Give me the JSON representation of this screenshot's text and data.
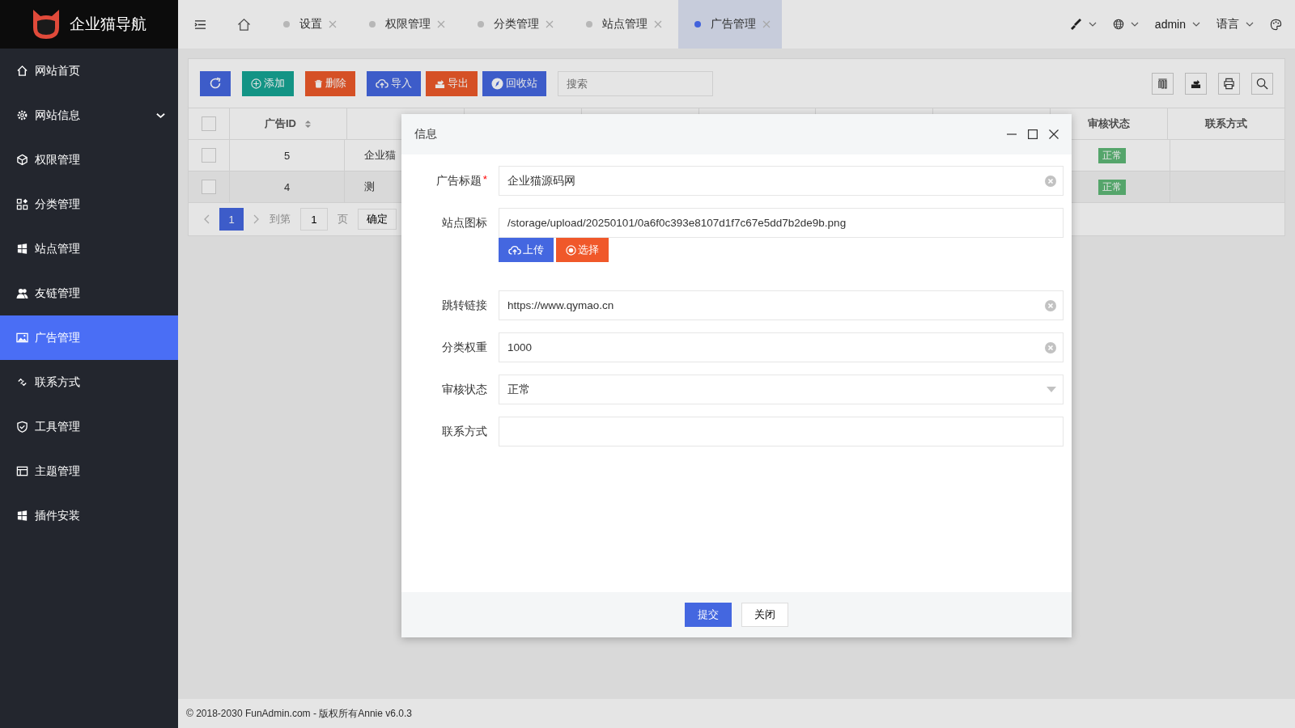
{
  "sidebar": {
    "logo_text": "企业猫导航",
    "items": [
      {
        "label": "网站首页",
        "selected": false,
        "expandable": false
      },
      {
        "label": "网站信息",
        "selected": false,
        "expandable": true
      },
      {
        "label": "权限管理",
        "selected": false,
        "expandable": false
      },
      {
        "label": "分类管理",
        "selected": false,
        "expandable": false
      },
      {
        "label": "站点管理",
        "selected": false,
        "expandable": false
      },
      {
        "label": "友链管理",
        "selected": false,
        "expandable": false
      },
      {
        "label": "广告管理",
        "selected": true,
        "expandable": false
      },
      {
        "label": "联系方式",
        "selected": false,
        "expandable": false
      },
      {
        "label": "工具管理",
        "selected": false,
        "expandable": false
      },
      {
        "label": "主题管理",
        "selected": false,
        "expandable": false
      },
      {
        "label": "插件安装",
        "selected": false,
        "expandable": false
      }
    ]
  },
  "tabs": [
    {
      "label": "设置",
      "selected": false
    },
    {
      "label": "权限管理",
      "selected": false
    },
    {
      "label": "分类管理",
      "selected": false
    },
    {
      "label": "站点管理",
      "selected": false
    },
    {
      "label": "广告管理",
      "selected": true
    }
  ],
  "user_menu": {
    "username": "admin",
    "language": "语言"
  },
  "toolbar": {
    "buttons": [
      {
        "kind": "refresh"
      },
      {
        "kind": "add",
        "label": "添加"
      },
      {
        "kind": "delete",
        "label": "删除"
      },
      {
        "kind": "import",
        "label": "导入"
      },
      {
        "kind": "export",
        "label": "导出"
      },
      {
        "kind": "recycle",
        "label": "回收站"
      }
    ],
    "search": {
      "placeholder": "搜索"
    }
  },
  "table": {
    "columns": [
      {
        "label": "广告ID",
        "sortable": true
      },
      {
        "label": "审核状态",
        "sortable": false
      },
      {
        "label": "联系方式",
        "sortable": false
      }
    ],
    "select_all_checked": false,
    "rows": [
      {
        "checked": false,
        "id": "5",
        "title": "企业猫",
        "status": "正常",
        "highlighted": false
      },
      {
        "checked": false,
        "id": "4",
        "title": "测",
        "status": "正常",
        "highlighted": true
      }
    ],
    "pagination": {
      "current": "1",
      "goto_label": "到第",
      "page_input": "1",
      "page_unit": "页",
      "confirm": "确定"
    }
  },
  "modal": {
    "title": "信息",
    "fields": [
      {
        "kind": "text",
        "label": "广告标题",
        "required_mark": "*",
        "value": "企业猫源码网",
        "clearable": true
      },
      {
        "kind": "upload",
        "label": "站点图标",
        "value": "/storage/upload/20250101/0a6f0c393e8107d1f7c67e5dd7b2de9b.png",
        "upload_label": "上传",
        "choose_label": "选择"
      },
      {
        "kind": "text",
        "label": "跳转链接",
        "value": "https://www.qymao.cn",
        "clearable": true
      },
      {
        "kind": "text",
        "label": "分类权重",
        "value": "1000",
        "clearable": true
      },
      {
        "kind": "select",
        "label": "审核状态",
        "value": "正常"
      },
      {
        "kind": "text",
        "label": "联系方式",
        "clearable": false
      }
    ],
    "submit": "提交",
    "close": "关闭"
  },
  "footer": "© 2018-2030 FunAdmin.com - 版权所有Annie v6.0.3"
}
